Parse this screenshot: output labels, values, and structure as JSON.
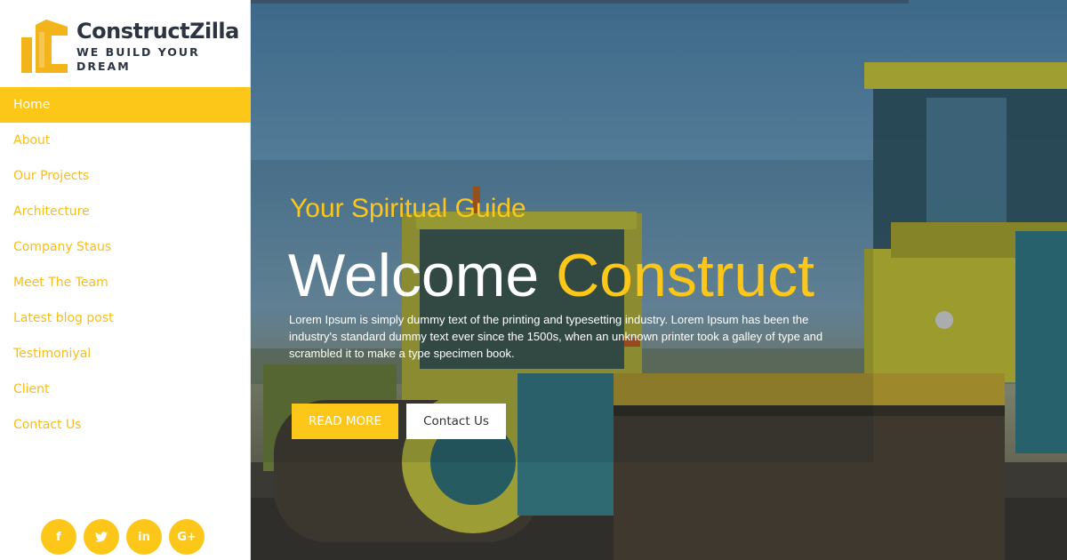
{
  "brand": {
    "name": "ConstructZilla",
    "tagline": "WE BUILD YOUR DREAM",
    "accent": "#fdc719",
    "dark": "#2b3440"
  },
  "nav": {
    "items": [
      {
        "label": "Home",
        "active": true
      },
      {
        "label": "About"
      },
      {
        "label": "Our Projects"
      },
      {
        "label": "Architecture"
      },
      {
        "label": "Company Staus"
      },
      {
        "label": "Meet The Team"
      },
      {
        "label": "Latest blog post"
      },
      {
        "label": "Testimoniyal"
      },
      {
        "label": "Client"
      },
      {
        "label": "Contact Us"
      }
    ]
  },
  "social": {
    "facebook": "f",
    "twitter": "t",
    "linkedin": "in",
    "googleplus": "G+"
  },
  "hero": {
    "eyebrow": "Your Spiritual Guide",
    "headline_white": "Welcome",
    "headline_accent": "Construct",
    "body": "Lorem Ipsum is simply dummy text of the printing and typesetting industry. Lorem Ipsum has been the industry's standard dummy text ever since the 1500s, when an unknown printer took a galley of type and scrambled it to make a type specimen book.",
    "primary_button": "READ MORE",
    "secondary_button": "Contact Us"
  }
}
